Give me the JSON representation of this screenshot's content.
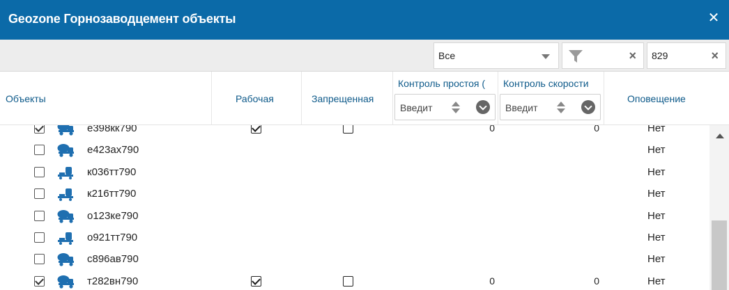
{
  "window": {
    "title": "Geozone Горнозаводцемент объекты",
    "close_icon": "close-icon"
  },
  "toolbar": {
    "select_value": "Все",
    "filter_icon": "funnel-icon",
    "filter_clear": "×",
    "search_value": "829",
    "search_clear": "×"
  },
  "header": {
    "objects": "Объекты",
    "working": "Рабочая",
    "forbidden": "Запрещенная",
    "idle_control": "Контроль простоя (",
    "idle_placeholder": "Введит",
    "speed_control": "Контроль скорости",
    "speed_placeholder": "Введит",
    "notification": "Оповещение"
  },
  "rows": [
    {
      "plate": "е398кк790",
      "icon": "concrete-mixer-icon",
      "selected": true,
      "working": true,
      "forbidden": false,
      "idle": "0",
      "speed": "0",
      "notify": "Нет"
    },
    {
      "plate": "е423ах790",
      "icon": "concrete-mixer-icon",
      "selected": false,
      "working": null,
      "forbidden": null,
      "idle": "",
      "speed": "",
      "notify": "Нет"
    },
    {
      "plate": "к036тт790",
      "icon": "dump-truck-icon",
      "selected": false,
      "working": null,
      "forbidden": null,
      "idle": "",
      "speed": "",
      "notify": "Нет"
    },
    {
      "plate": "к216тт790",
      "icon": "dump-truck-icon",
      "selected": false,
      "working": null,
      "forbidden": null,
      "idle": "",
      "speed": "",
      "notify": "Нет"
    },
    {
      "plate": "о123ке790",
      "icon": "concrete-mixer-icon",
      "selected": false,
      "working": null,
      "forbidden": null,
      "idle": "",
      "speed": "",
      "notify": "Нет"
    },
    {
      "plate": "о921тт790",
      "icon": "dump-truck-icon",
      "selected": false,
      "working": null,
      "forbidden": null,
      "idle": "",
      "speed": "",
      "notify": "Нет"
    },
    {
      "plate": "с896ав790",
      "icon": "concrete-mixer-icon",
      "selected": false,
      "working": null,
      "forbidden": null,
      "idle": "",
      "speed": "",
      "notify": "Нет"
    },
    {
      "plate": "т282вн790",
      "icon": "concrete-mixer-icon",
      "selected": true,
      "working": true,
      "forbidden": false,
      "idle": "0",
      "speed": "0",
      "notify": "Нет"
    }
  ],
  "colors": {
    "titlebar": "#0b6aa8",
    "header_text": "#0e5a8a",
    "icon_blue": "#1f6fb0"
  }
}
